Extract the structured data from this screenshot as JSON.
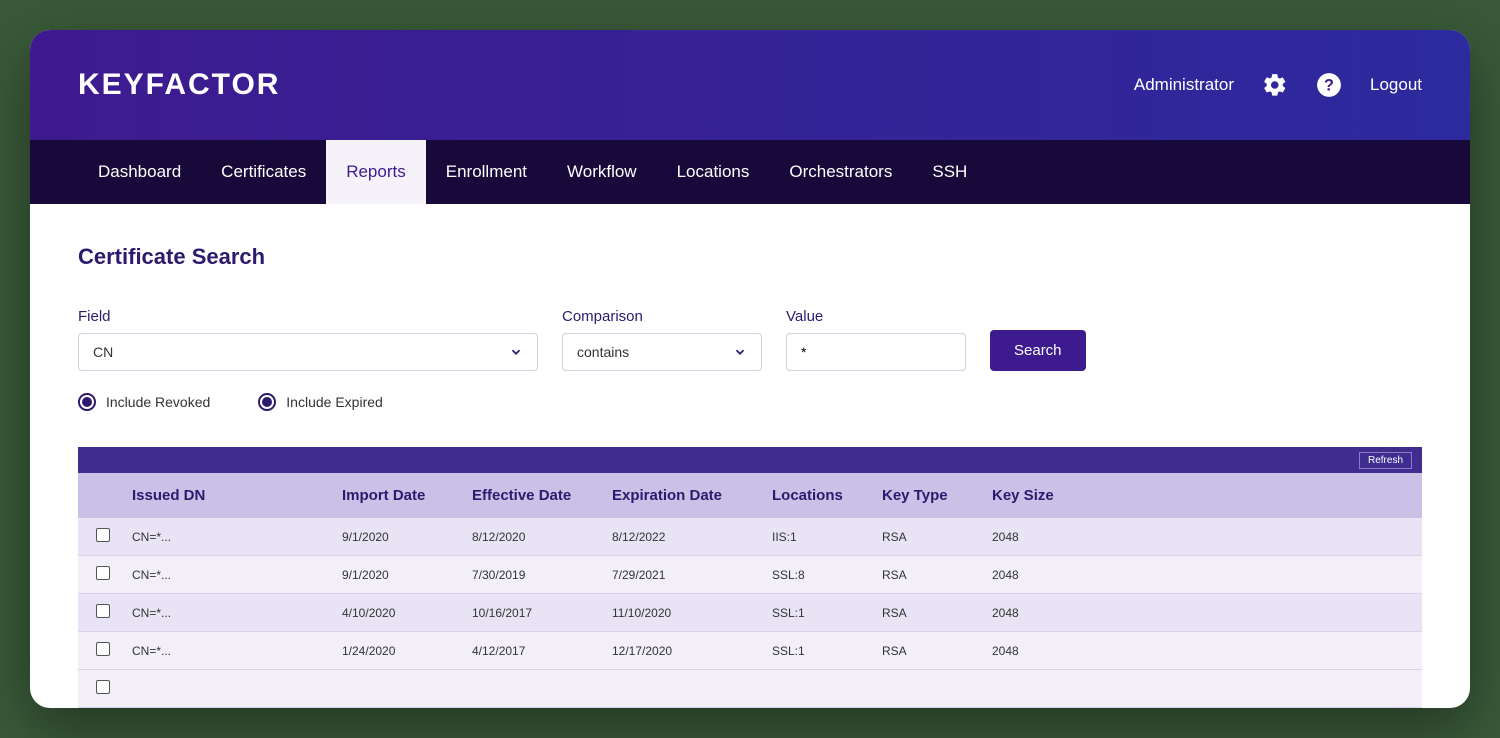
{
  "topbar": {
    "logo": "KEYFACTOR",
    "user": "Administrator",
    "logout": "Logout"
  },
  "nav": {
    "items": [
      "Dashboard",
      "Certificates",
      "Reports",
      "Enrollment",
      "Workflow",
      "Locations",
      "Orchestrators",
      "SSH"
    ],
    "active": 2
  },
  "page": {
    "title": "Certificate Search"
  },
  "search": {
    "field_label": "Field",
    "field_value": "CN",
    "comparison_label": "Comparison",
    "comparison_value": "contains",
    "value_label": "Value",
    "value_value": "*",
    "button": "Search",
    "include_revoked": "Include Revoked",
    "include_expired": "Include Expired"
  },
  "table": {
    "refresh": "Refresh",
    "headers": [
      "Issued DN",
      "Import Date",
      "Effective Date",
      "Expiration Date",
      "Locations",
      "Key Type",
      "Key Size"
    ],
    "rows": [
      {
        "dn": "CN=*...",
        "import": "9/1/2020",
        "effective": "8/12/2020",
        "expiration": "8/12/2022",
        "locations": "IIS:1",
        "keytype": "RSA",
        "keysize": "2048"
      },
      {
        "dn": "CN=*...",
        "import": "9/1/2020",
        "effective": "7/30/2019",
        "expiration": "7/29/2021",
        "locations": "SSL:8",
        "keytype": "RSA",
        "keysize": "2048"
      },
      {
        "dn": "CN=*...",
        "import": "4/10/2020",
        "effective": "10/16/2017",
        "expiration": "11/10/2020",
        "locations": "SSL:1",
        "keytype": "RSA",
        "keysize": "2048"
      },
      {
        "dn": "CN=*...",
        "import": "1/24/2020",
        "effective": "4/12/2017",
        "expiration": "12/17/2020",
        "locations": "SSL:1",
        "keytype": "RSA",
        "keysize": "2048"
      }
    ]
  }
}
